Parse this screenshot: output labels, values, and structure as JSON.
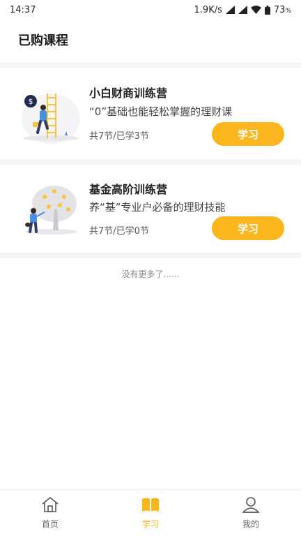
{
  "status_bar": {
    "time": "14:37",
    "network_speed": "1.9K/s",
    "battery": "73",
    "battery_unit": "%",
    "icons": [
      "signal-icon",
      "signal-icon",
      "wifi-icon",
      "battery-icon"
    ]
  },
  "page": {
    "title": "已购课程"
  },
  "courses": [
    {
      "title": "小白财商训练营",
      "desc": "“0”基础也能轻松掌握的理财课",
      "progress": "共7节/已学3节",
      "button": "学习",
      "illustration": "person-climbing-ladder-illustration"
    },
    {
      "title": "基金高阶训练营",
      "desc": "养“基”专业户必备的理财技能",
      "progress": "共7节/已学0节",
      "button": "学习",
      "illustration": "person-watering-money-tree-illustration"
    }
  ],
  "list_footer": "没有更多了......",
  "tabbar": {
    "items": [
      {
        "label": "首页",
        "icon": "home-icon",
        "active": false
      },
      {
        "label": "学习",
        "icon": "book-icon",
        "active": true
      },
      {
        "label": "我的",
        "icon": "user-icon",
        "active": false
      }
    ]
  },
  "colors": {
    "accent": "#fbb51d",
    "separator": "#f5f5f5"
  }
}
